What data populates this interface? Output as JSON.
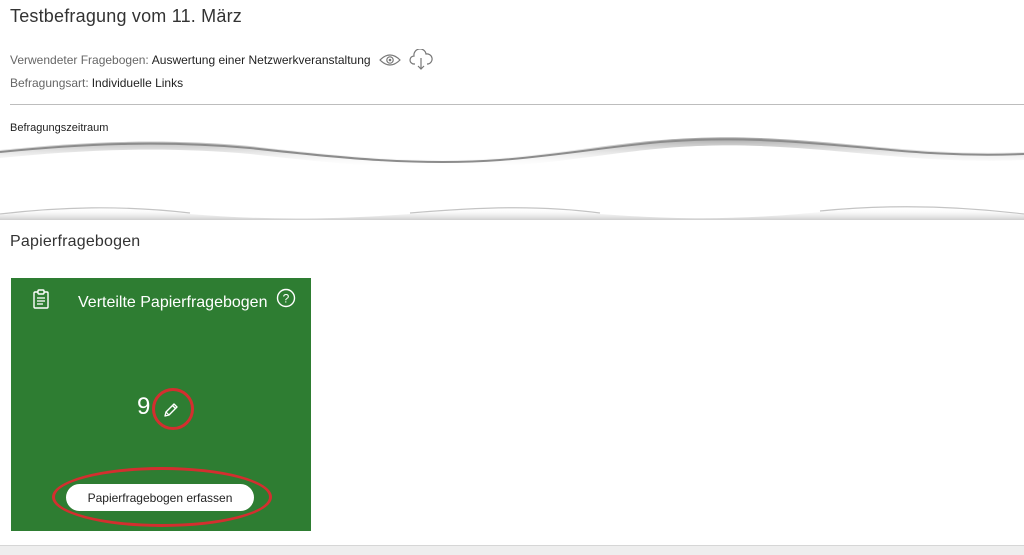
{
  "survey": {
    "title": "Testbefragung vom 11. März",
    "questionnaire_label": "Verwendeter Fragebogen:",
    "questionnaire_value": "Auswertung einer Netzwerkveranstaltung",
    "type_label": "Befragungsart:",
    "type_value": "Individuelle Links",
    "period_label": "Befragungszeitraum"
  },
  "paper": {
    "section_title": "Papierfragebogen",
    "card": {
      "title": "Verteilte Papierfragebogen",
      "count": "9",
      "capture_button": "Papierfragebogen erfassen",
      "color": "#2e7d32"
    }
  },
  "icons": {
    "preview": "eye-icon",
    "download": "cloud-download-icon",
    "clipboard": "clipboard-icon",
    "help": "help-circle-icon",
    "edit": "pencil-icon"
  },
  "highlight_color": "#d32f2f"
}
